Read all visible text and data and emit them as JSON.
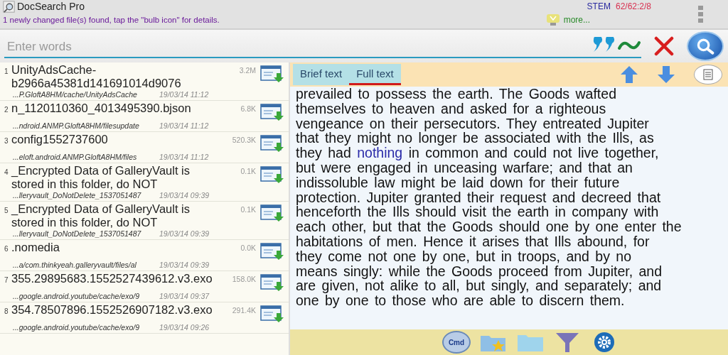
{
  "app": {
    "title": "DocSearch Pro",
    "notice": "1 newly changed file(s) found, tap the \"bulb icon\" for details.",
    "stem_label": "STEM",
    "stem_value": "62/62:2/8",
    "more_link": "more..."
  },
  "search": {
    "placeholder": "Enter words"
  },
  "results": [
    {
      "index": "1",
      "name": "UnityAdsCache-b2966a45381d141691014d9076",
      "size": "3.2M",
      "path": "...P.GloftA8HM/cache/UnityAdsCache",
      "date": "19/03/14 11:12"
    },
    {
      "index": "2",
      "name": "n_1120110360_4013495390.bjson",
      "size": "6.8K",
      "path": "...ndroid.ANMP.GloftA8HM/filesupdate",
      "date": "19/03/14 11:12"
    },
    {
      "index": "3",
      "name": "config1552737600",
      "size": "520.3K",
      "path": "...eloft.android.ANMP.GloftA8HM/files",
      "date": "19/03/14 11:12"
    },
    {
      "index": "4",
      "name": "_Encrypted Data of GalleryVault is stored in this folder, do NOT",
      "size": "0.1K",
      "path": "...lleryvault_DoNotDelete_1537051487",
      "date": "19/03/14 09:39"
    },
    {
      "index": "5",
      "name": "_Encrypted Data of GalleryVault is stored in this folder, do NOT",
      "size": "0.1K",
      "path": "...lleryvault_DoNotDelete_1537051487",
      "date": "19/03/14 09:39"
    },
    {
      "index": "6",
      "name": ".nomedia",
      "size": "0.0K",
      "path": "...a/com.thinkyeah.galleryvault/files/al",
      "date": "19/03/14 09:39"
    },
    {
      "index": "7",
      "name": "355.29895683.1552527439612.v3.exo",
      "size": "158.0K",
      "path": "...google.android.youtube/cache/exo/9",
      "date": "19/03/14 09:37"
    },
    {
      "index": "8",
      "name": "354.78507896.1552526907182.v3.exo",
      "size": "291.4K",
      "path": "...google.android.youtube/cache/exo/9",
      "date": "19/03/14 09:26"
    }
  ],
  "tabs": [
    {
      "label": "Brief text",
      "selected": false
    },
    {
      "label": "Full text",
      "selected": true
    }
  ],
  "document": {
    "lines": [
      [
        {
          "text": "prevailed to possess the earth. The Goods wafted",
          "highlight": false
        }
      ],
      [
        {
          "text": "themselves to heaven and asked for a righteous",
          "highlight": false
        }
      ],
      [
        {
          "text": "vengeance on their persecutors. They entreated Jupiter",
          "highlight": false
        }
      ],
      [
        {
          "text": "that they might no longer be associated with the Ills, as",
          "highlight": false
        }
      ],
      [
        {
          "text": "they had ",
          "highlight": false
        },
        {
          "text": "nothing",
          "highlight": true
        },
        {
          "text": " in common and could not live together,",
          "highlight": false
        }
      ],
      [
        {
          "text": "but were engaged in unceasing warfare; and that an",
          "highlight": false
        }
      ],
      [
        {
          "text": "indissoluble law might be laid down for their future",
          "highlight": false
        }
      ],
      [
        {
          "text": "protection. Jupiter granted their request and decreed that",
          "highlight": false
        }
      ],
      [
        {
          "text": "henceforth the Ills should visit the earth in company with",
          "highlight": false
        }
      ],
      [
        {
          "text": "each other, but that the Goods should one by one enter the",
          "highlight": false
        }
      ],
      [
        {
          "text": "habitations of men. Hence it arises that Ills abound, for",
          "highlight": false
        }
      ],
      [
        {
          "text": "they come not one by one, but in troops, and by no",
          "highlight": false
        }
      ],
      [
        {
          "text": "means singly: while the Goods proceed from Jupiter, and",
          "highlight": false
        }
      ],
      [
        {
          "text": "are given, not alike to all, but singly, and separately; and",
          "highlight": false
        }
      ],
      [
        {
          "text": "one by one to those who are able to discern them.",
          "highlight": false
        }
      ]
    ]
  },
  "bottom_bar": {
    "cmd_label": "Cmd"
  }
}
